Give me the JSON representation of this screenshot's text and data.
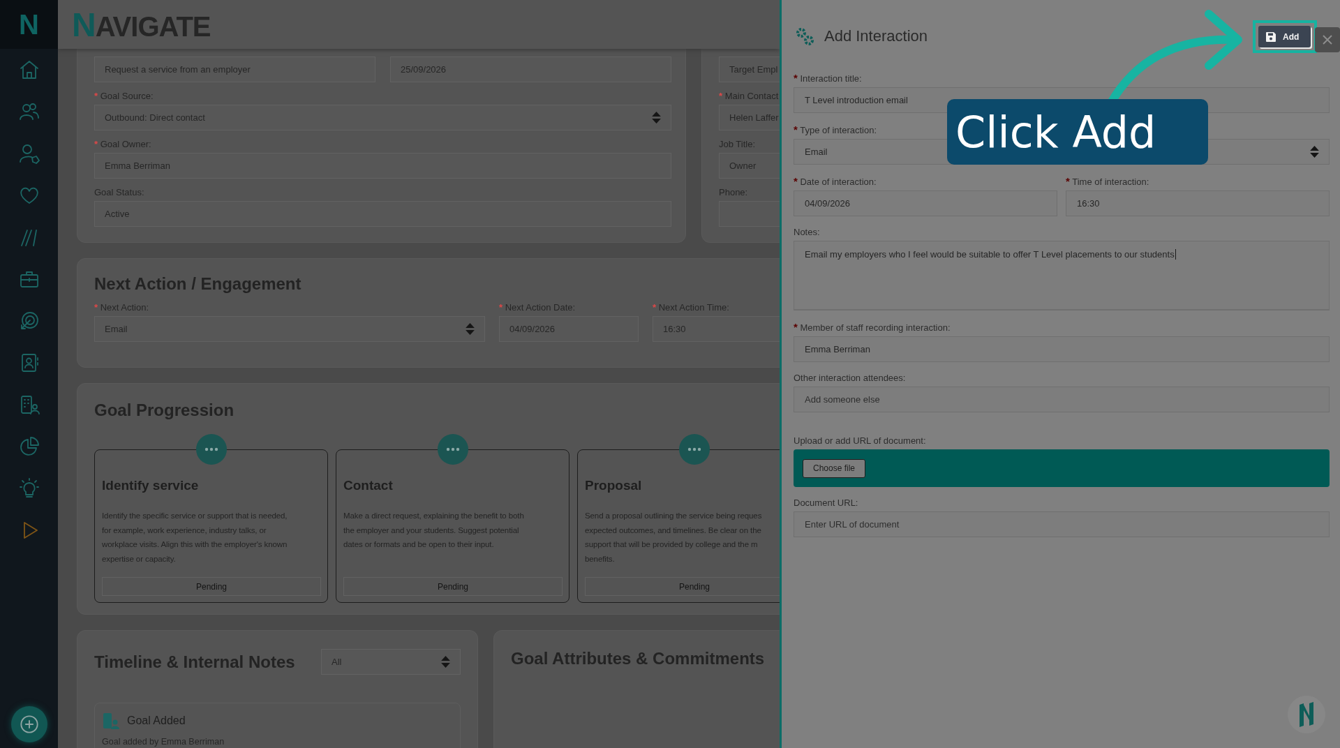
{
  "sidebar": {
    "logo": "N"
  },
  "header": {
    "brand": "NAVIGATE"
  },
  "goal_details": {
    "rows": [
      [
        {
          "kind": "text",
          "value": "Request a service from an employer"
        },
        {
          "kind": "text",
          "value": "25/09/2026"
        }
      ],
      [
        {
          "kind": "select",
          "required_mark": "*",
          "label": "Goal Source:",
          "value": "Outbound: Direct contact"
        }
      ],
      [
        {
          "kind": "text",
          "required_mark": "*",
          "label": "Goal Owner:",
          "value": "Emma Berriman"
        }
      ],
      [
        {
          "kind": "text",
          "label": "Goal Status:",
          "value": "Active"
        }
      ]
    ]
  },
  "contact_details": {
    "fields": [
      {
        "kind": "text",
        "value": "Target Empl"
      },
      {
        "kind": "text",
        "required_mark": "*",
        "label": "Main Contact",
        "value": "Helen Laffer"
      },
      {
        "kind": "text",
        "label": "Job Title:",
        "value": "Owner"
      },
      {
        "kind": "text",
        "label": "Phone:"
      }
    ]
  },
  "next_action": {
    "heading": "Next Action / Engagement",
    "fields": [
      {
        "kind": "select",
        "required_mark": "*",
        "label": "Next Action:",
        "value": "Email"
      },
      {
        "kind": "text",
        "required_mark": "*",
        "label": "Next Action Date:",
        "value": "04/09/2026"
      },
      {
        "kind": "text",
        "required_mark": "*",
        "label": "Next Action Time:",
        "value": "16:30"
      }
    ]
  },
  "goal_progression": {
    "heading": "Goal Progression",
    "steps": [
      {
        "title": "Identify service",
        "lines": [
          "Identify the specific service or support that is needed,",
          "for example, work experience, industry talks, or",
          "workplace visits. Align this with the employer's known",
          "expertise or capacity."
        ],
        "status": "Pending"
      },
      {
        "title": "Contact",
        "lines": [
          "Make a direct request, explaining the benefit to both",
          "the employer and your students. Suggest potential",
          "dates or formats and be open to their input."
        ],
        "status": "Pending"
      },
      {
        "title": "Proposal",
        "lines": [
          "Send a proposal outlining the service being reques",
          "expected outcomes, and timelines. Be clear on the",
          "support that will be provided by college and the m",
          "benefits."
        ],
        "status": "Pending"
      }
    ]
  },
  "timeline": {
    "heading": "Timeline & Internal Notes",
    "filter": "All",
    "entries": [
      {
        "title": "Goal Added",
        "text": "Goal added by Emma Berriman"
      }
    ]
  },
  "goal_attributes": {
    "heading": "Goal Attributes & Commitments"
  },
  "panel": {
    "title": "Add Interaction",
    "add_button": "Add",
    "fields": [
      {
        "kind": "text",
        "required_mark": "*",
        "label": "Interaction title:",
        "value": "T Level introduction email"
      },
      {
        "kind": "select",
        "required_mark": "*",
        "label": "Type of interaction:",
        "value": "Email"
      },
      {
        "kind": "pair",
        "items": [
          {
            "kind": "text",
            "required_mark": "*",
            "label": "Date of interaction:",
            "value": "04/09/2026"
          },
          {
            "kind": "text",
            "required_mark": "*",
            "label": "Time of interaction:",
            "value": "16:30"
          }
        ]
      },
      {
        "kind": "textarea",
        "label": "Notes:",
        "value": "Email my employers who I feel would be suitable to offer T Level placements to our students"
      },
      {
        "kind": "text",
        "required_mark": "*",
        "label": "Member of staff recording interaction:",
        "value": "Emma Berriman"
      },
      {
        "kind": "text",
        "label": "Other interaction attendees:",
        "placeholder": "Add someone else"
      },
      {
        "kind": "file",
        "label": "Upload or add URL of document:",
        "button": "Choose file"
      },
      {
        "kind": "text",
        "label": "Document URL:",
        "placeholder": "Enter URL of document"
      }
    ]
  },
  "callout": {
    "text": "Click Add"
  }
}
